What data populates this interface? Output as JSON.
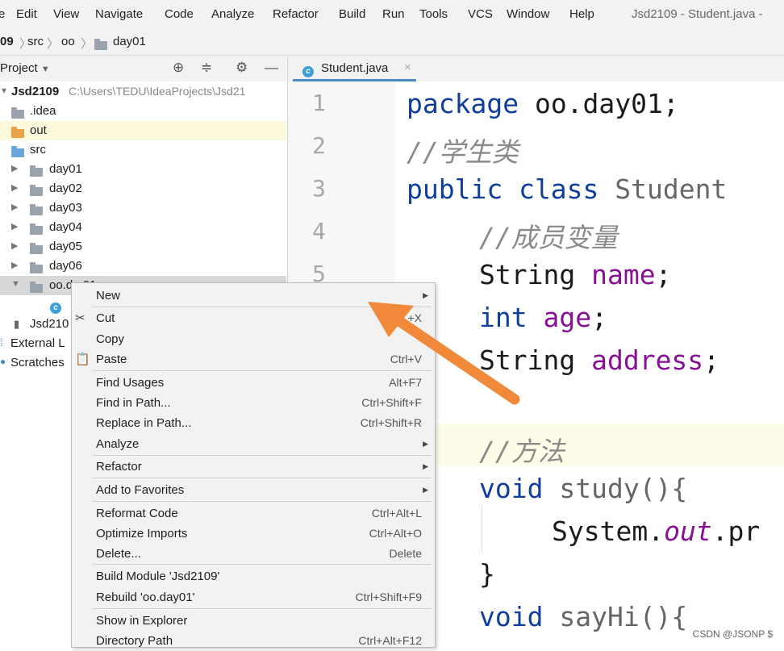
{
  "window_title": "Jsd2109 - Student.java -",
  "menu": [
    "e",
    "Edit",
    "View",
    "Navigate",
    "Code",
    "Analyze",
    "Refactor",
    "Build",
    "Run",
    "Tools",
    "VCS",
    "Window",
    "Help"
  ],
  "breadcrumb": {
    "root": "09",
    "src": "src",
    "oo": "oo",
    "day01": "day01"
  },
  "project_panel": {
    "title": "Project",
    "root_name": "Jsd2109",
    "root_path": "C:\\Users\\TEDU\\IdeaProjects\\Jsd21",
    "items": [
      {
        "label": ".idea"
      },
      {
        "label": "out"
      },
      {
        "label": "src"
      },
      {
        "label": "day01"
      },
      {
        "label": "day02"
      },
      {
        "label": "day03"
      },
      {
        "label": "day04"
      },
      {
        "label": "day05"
      },
      {
        "label": "day06"
      },
      {
        "label": "oo.d...01"
      },
      {
        "label": "Jsd210"
      },
      {
        "label": "External L"
      },
      {
        "label": "Scratches"
      }
    ]
  },
  "tab": {
    "label": "Student.java",
    "close": "×"
  },
  "line_numbers": [
    "1",
    "2",
    "3",
    "4",
    "5"
  ],
  "code": {
    "l1_kw": "package",
    "l1_rest": " oo.day01;",
    "l2": "//学生类",
    "l3_kw": "public class",
    "l3_rest": " Student",
    "l4": "//成员变量",
    "l5_type": "String",
    "l5_sp": " ",
    "l5_field": "name",
    "l5_end": ";",
    "l6_type": "int",
    "l6_sp": " ",
    "l6_field": "age",
    "l6_end": ";",
    "l7_type": "String",
    "l7_sp": " ",
    "l7_field": "address",
    "l7_end": ";",
    "l9": "//方法",
    "l10_kw": "void",
    "l10_rest": " study(){",
    "l11_a": "System.",
    "l11_b": "out",
    "l11_c": ".pr",
    "l12": "}",
    "l13_kw": "void",
    "l13_rest": " sayHi(){"
  },
  "context_menu": {
    "new": "New",
    "cut": "Cut",
    "cut_sc": "+X",
    "copy": "Copy",
    "paste": "Paste",
    "paste_sc": "Ctrl+V",
    "find_usages": "Find Usages",
    "find_usages_sc": "Alt+F7",
    "find_in_path": "Find in Path...",
    "find_in_path_sc": "Ctrl+Shift+F",
    "replace_in_path": "Replace in Path...",
    "replace_in_path_sc": "Ctrl+Shift+R",
    "analyze": "Analyze",
    "refactor": "Refactor",
    "add_to_favorites": "Add to Favorites",
    "reformat_code": "Reformat Code",
    "reformat_code_sc": "Ctrl+Alt+L",
    "optimize_imports": "Optimize Imports",
    "optimize_imports_sc": "Ctrl+Alt+O",
    "delete": "Delete...",
    "delete_sc": "Delete",
    "build_module": "Build Module 'Jsd2109'",
    "rebuild": "Rebuild 'oo.day01'",
    "rebuild_sc": "Ctrl+Shift+F9",
    "show_in_explorer": "Show in Explorer",
    "directory_path": "Directory Path",
    "directory_path_sc": "Ctrl+Alt+F12"
  },
  "annotation_arrow_color": "#f08a3a",
  "watermark": "CSDN @JSONP $"
}
